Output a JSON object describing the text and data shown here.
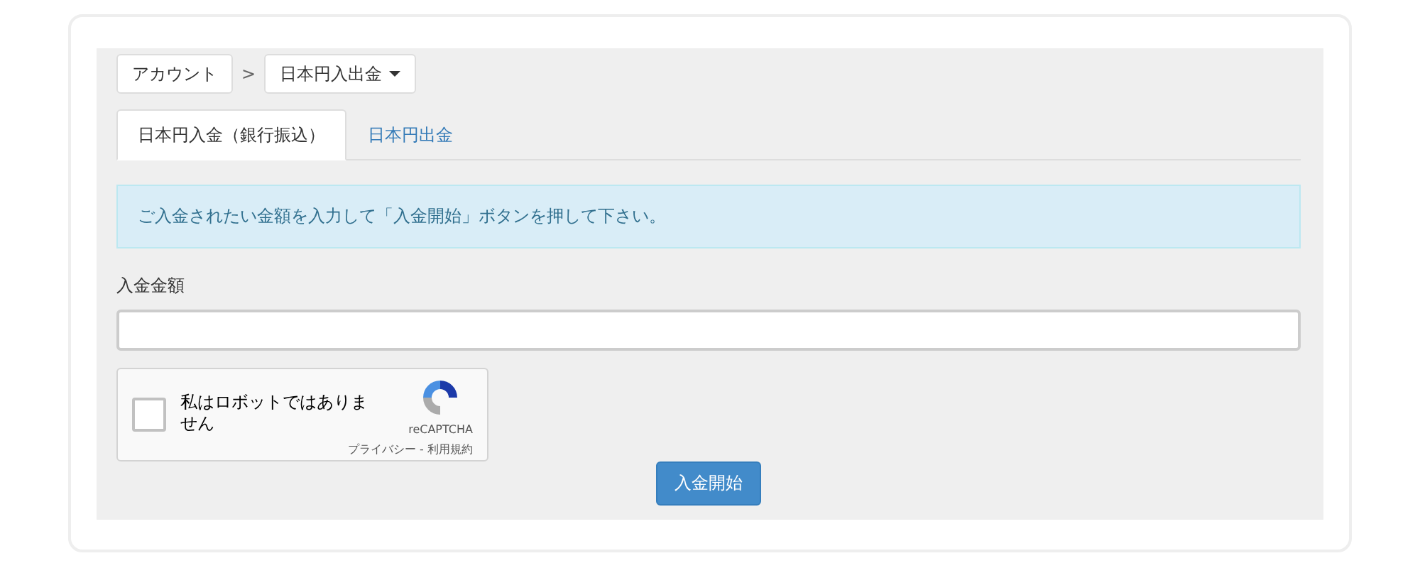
{
  "breadcrumb": [
    {
      "label": "アカウント",
      "kind": "link"
    },
    {
      "label": ">",
      "kind": "separator"
    },
    {
      "label": "日本円入出金",
      "kind": "dropdown"
    }
  ],
  "tabs": [
    {
      "label": "日本円入金（銀行振込）",
      "selected": true
    },
    {
      "label": "日本円出金",
      "selected": false
    }
  ],
  "alert": "ご入金されたい金額を入力して「入金開始」ボタンを押して下さい。",
  "amount_field": {
    "label": "入金金額"
  },
  "captcha": {
    "label": "私はロボットではありません",
    "checked": false,
    "brand": "reCAPTCHA",
    "footer": "プライバシー - 利用規約"
  },
  "submit_button": "入金開始"
}
